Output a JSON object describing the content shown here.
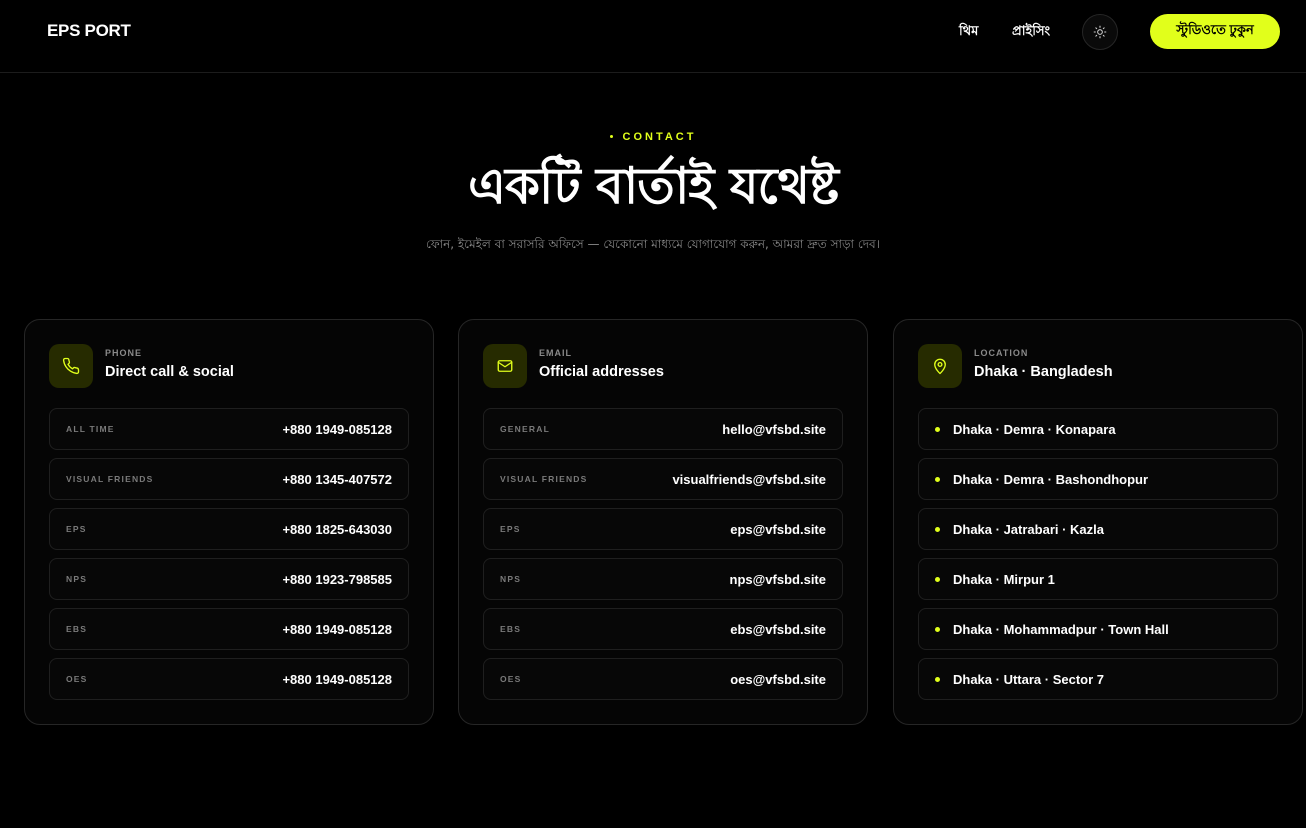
{
  "header": {
    "logo": "EPS PORT",
    "nav": [
      {
        "label": "থিম"
      },
      {
        "label": "প্রাইসিং"
      }
    ],
    "cta_label": "স্টুডিওতে ঢুকুন"
  },
  "hero": {
    "eyebrow": "CONTACT",
    "title": "একটি বার্তাই যথেষ্ট",
    "subtitle": "ফোন, ইমেইল বা সরাসরি অফিসে — যেকোনো মাধ্যমে যোগাযোগ করুন, আমরা দ্রুত সাড়া দেব।"
  },
  "cards": {
    "phone": {
      "icon": "phone-icon",
      "kicker": "PHONE",
      "title": "Direct call & social",
      "rows": [
        {
          "label": "ALL TIME",
          "value": "+880 1949-085128"
        },
        {
          "label": "VISUAL FRIENDS",
          "value": "+880 1345-407572"
        },
        {
          "label": "EPS",
          "value": "+880 1825-643030"
        },
        {
          "label": "NPS",
          "value": "+880 1923-798585"
        },
        {
          "label": "EBS",
          "value": "+880 1949-085128"
        },
        {
          "label": "OES",
          "value": "+880 1949-085128"
        }
      ]
    },
    "email": {
      "icon": "mail-icon",
      "kicker": "EMAIL",
      "title": "Official addresses",
      "rows": [
        {
          "label": "GENERAL",
          "value": "hello@vfsbd.site"
        },
        {
          "label": "VISUAL FRIENDS",
          "value": "visualfriends@vfsbd.site"
        },
        {
          "label": "EPS",
          "value": "eps@vfsbd.site"
        },
        {
          "label": "NPS",
          "value": "nps@vfsbd.site"
        },
        {
          "label": "EBS",
          "value": "ebs@vfsbd.site"
        },
        {
          "label": "OES",
          "value": "oes@vfsbd.site"
        }
      ]
    },
    "location": {
      "icon": "map-pin-icon",
      "kicker": "LOCATION",
      "title": "Dhaka · Bangladesh",
      "rows": [
        {
          "value": "Dhaka · Demra · Konapara"
        },
        {
          "value": "Dhaka · Demra · Bashondhopur"
        },
        {
          "value": "Dhaka · Jatrabari · Kazla"
        },
        {
          "value": "Dhaka · Mirpur 1"
        },
        {
          "value": "Dhaka · Mohammadpur · Town Hall"
        },
        {
          "value": "Dhaka · Uttara · Sector 7"
        }
      ]
    }
  },
  "colors": {
    "accent": "#e1ff1b",
    "background": "#000000",
    "card_border": "#262626",
    "muted_text": "#8a8a8a"
  }
}
